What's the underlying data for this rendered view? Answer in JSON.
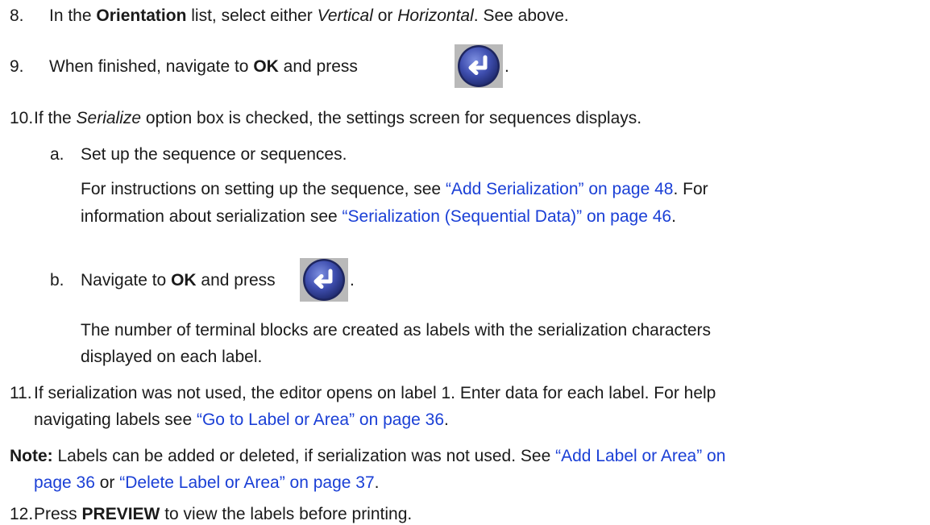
{
  "steps": {
    "s8": {
      "num": "8.",
      "a": "In the ",
      "b": "Orientation",
      "c": " list, select either ",
      "d": "Vertical",
      "e": " or ",
      "f": "Horizontal",
      "g": ". See above."
    },
    "s9": {
      "num": "9.",
      "a": "When finished, navigate to ",
      "b": "OK",
      "c": " and press",
      "end": "."
    },
    "s10": {
      "num": "10.",
      "a": "If the ",
      "b": "Serialize",
      "c": " option box is checked, the settings screen for sequences displays."
    },
    "s10a": {
      "num": "a.",
      "text": "Set up the sequence or sequences."
    },
    "s10a_p": {
      "l1a": "For instructions on setting up the sequence, see ",
      "l1link": "“Add Serialization” on page 48",
      "l1b": ". For",
      "l2a": "information about serialization see ",
      "l2link": "“Serialization (Sequential Data)” on page 46",
      "l2b": "."
    },
    "s10b": {
      "num": "b.",
      "a": "Navigate to ",
      "b": "OK",
      "c": " and press",
      "end": "."
    },
    "s10b_p": {
      "l1": "The number of terminal blocks are created as labels with the serialization characters",
      "l2": "displayed on each label."
    },
    "s11": {
      "num": "11.",
      "l1": "If serialization was not used, the editor opens on label 1. Enter data for each label. For help",
      "l2a": "navigating labels see ",
      "l2link": "“Go to Label or Area” on page 36",
      "l2b": "."
    },
    "note": {
      "label": "Note:",
      "l1a": " Labels can be added or deleted, if serialization was not used. See ",
      "l1link": "“Add Label or Area” on",
      "l2link1": "page 36",
      "l2mid": " or ",
      "l2link2": "“Delete Label or Area” on page 37",
      "l2b": "."
    },
    "s12": {
      "num": "12.",
      "a": "Press ",
      "b": "PREVIEW",
      "c": " to view the labels before printing."
    }
  },
  "icons": {
    "enter_key": "enter-arrow-icon"
  },
  "colors": {
    "link": "#1a3fd6",
    "button_blue": "#3d4fa8"
  }
}
